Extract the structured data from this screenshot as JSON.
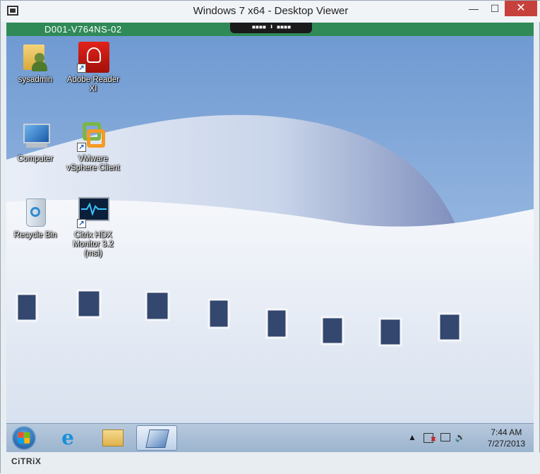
{
  "window": {
    "title": "Windows 7 x64 - Desktop Viewer",
    "min": "—",
    "max": "☐",
    "close": "✕"
  },
  "vm_bar": {
    "name": "D001-V764NS-02",
    "handle": "▪▪▪▪ ⬇ ▪▪▪▪"
  },
  "desktop_icons": [
    {
      "label": "sysadmin",
      "icon": "user-folder-icon"
    },
    {
      "label": "Adobe Reader XI",
      "icon": "adobe-reader-icon"
    },
    {
      "label": "Computer",
      "icon": "computer-icon"
    },
    {
      "label": "VMware vSphere Client",
      "icon": "vmware-icon"
    },
    {
      "label": "Recycle Bin",
      "icon": "recycle-bin-icon"
    },
    {
      "label": "Citrix HDX Monitor 3.2 (msi)",
      "icon": "hdx-monitor-icon"
    }
  ],
  "taskbar": {
    "clock_time": "7:44 AM",
    "clock_date": "7/27/2013",
    "tray_up": "▲"
  },
  "footer": {
    "brand": "CiTRiX"
  }
}
